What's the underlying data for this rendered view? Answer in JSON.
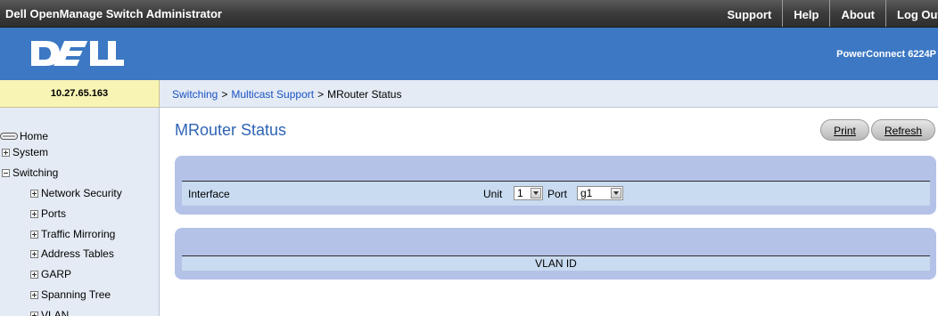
{
  "app": {
    "title": "Dell OpenManage Switch Administrator",
    "links": [
      "Support",
      "Help",
      "About",
      "Log Out"
    ]
  },
  "brand": {
    "logo_text": "DELL",
    "model": "PowerConnect 6224P"
  },
  "ip_address": "10.27.65.163",
  "breadcrumb": {
    "items": [
      "Switching",
      "Multicast Support"
    ],
    "separator": ">",
    "current": "MRouter Status"
  },
  "sidebar": {
    "items": [
      {
        "label": "Home",
        "icon": "home-icon"
      },
      {
        "label": "System",
        "icon": "expand-icon"
      },
      {
        "label": "Switching",
        "icon": "collapse-icon"
      },
      {
        "label": "Network Security",
        "icon": "expand-icon"
      },
      {
        "label": "Ports",
        "icon": "expand-icon"
      },
      {
        "label": "Traffic Mirroring",
        "icon": "expand-icon"
      },
      {
        "label": "Address Tables",
        "icon": "expand-icon"
      },
      {
        "label": "GARP",
        "icon": "expand-icon"
      },
      {
        "label": "Spanning Tree",
        "icon": "expand-icon"
      },
      {
        "label": "VLAN",
        "icon": "expand-icon"
      }
    ]
  },
  "page": {
    "title": "MRouter Status",
    "buttons": {
      "print": "Print",
      "refresh": "Refresh"
    },
    "interface": {
      "label": "Interface",
      "unit_label": "Unit",
      "unit_value": "1",
      "port_label": "Port",
      "port_value": "g1"
    },
    "table": {
      "columns": [
        "VLAN ID"
      ]
    }
  },
  "colors": {
    "topbar": "#3b3b3b",
    "brand_band": "#3c78c3",
    "ip_box": "#f8f4b4",
    "nav_background": "#e4ebf4",
    "panel": "#b4c2e8",
    "panel_inner": "#c9dbf0",
    "title": "#2e64b4",
    "link": "#1a52c4"
  }
}
